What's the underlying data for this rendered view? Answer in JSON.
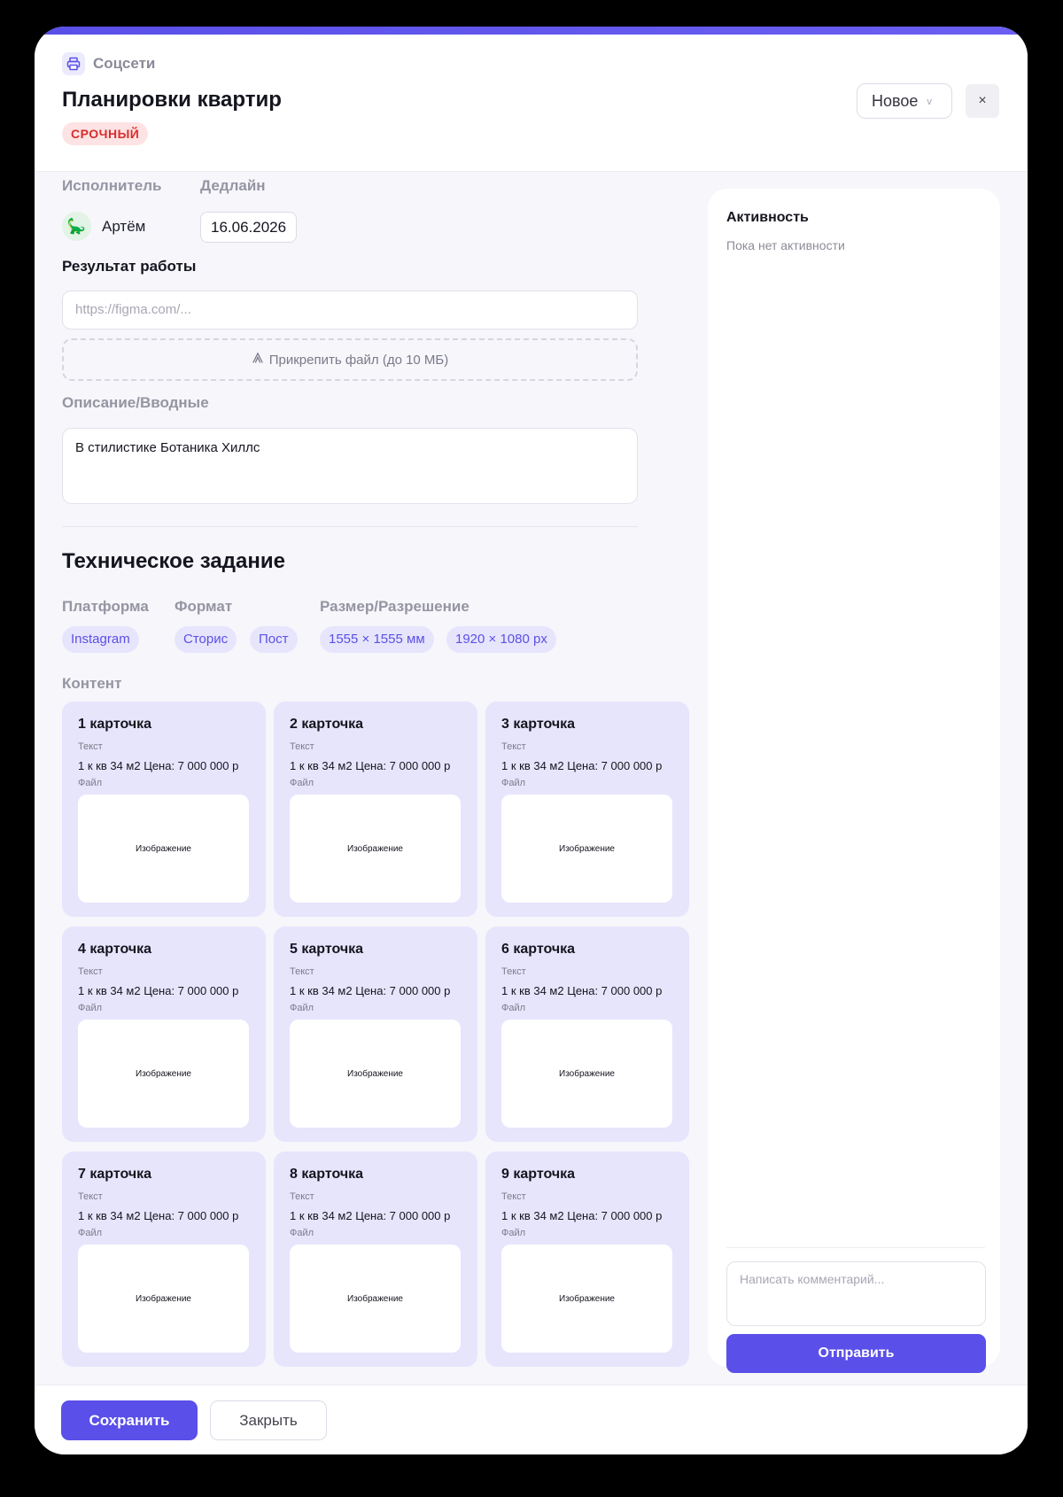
{
  "header": {
    "breadcrumb": "Соцсети",
    "breadcrumb_icon": "printer-icon",
    "title": "Планировки квартир",
    "priority_badge": "СРОЧНЫЙ",
    "status": "Новое",
    "close": "×"
  },
  "meta": {
    "assignee_label": "Исполнитель",
    "assignee_name": "Артём",
    "assignee_avatar": "🦕",
    "deadline_label": "Дедлайн",
    "deadline": "16.06.2026"
  },
  "result": {
    "label": "Результат работы",
    "url_placeholder": "https://figma.com/...",
    "attach_label": "Прикрепить файл (до 10 МБ)"
  },
  "description": {
    "label": "Описание/Вводные",
    "value": "В стилистике Ботаника Хиллс"
  },
  "tech": {
    "heading": "Техническое задание",
    "platform_label": "Платформа",
    "format_label": "Формат",
    "size_label": "Размер/Разрешение",
    "platforms": [
      "Instagram"
    ],
    "formats": [
      "Сторис",
      "Пост"
    ],
    "sizes": [
      "1555 × 1555 мм",
      "1920 × 1080 px"
    ],
    "content_label": "Контент"
  },
  "cards": [
    {
      "title": "1 карточка",
      "text_label": "Текст",
      "text": "1 к кв 34 м2 Цена: 7 000 000 р",
      "file_label": "Файл",
      "image": "Изображение"
    },
    {
      "title": "2 карточка",
      "text_label": "Текст",
      "text": "1 к кв 34 м2 Цена: 7 000 000 р",
      "file_label": "Файл",
      "image": "Изображение"
    },
    {
      "title": "3 карточка",
      "text_label": "Текст",
      "text": "1 к кв 34 м2 Цена: 7 000 000 р",
      "file_label": "Файл",
      "image": "Изображение"
    },
    {
      "title": "4 карточка",
      "text_label": "Текст",
      "text": "1 к кв 34 м2 Цена: 7 000 000 р",
      "file_label": "Файл",
      "image": "Изображение"
    },
    {
      "title": "5 карточка",
      "text_label": "Текст",
      "text": "1 к кв 34 м2 Цена: 7 000 000 р",
      "file_label": "Файл",
      "image": "Изображение"
    },
    {
      "title": "6 карточка",
      "text_label": "Текст",
      "text": "1 к кв 34 м2 Цена: 7 000 000 р",
      "file_label": "Файл",
      "image": "Изображение"
    },
    {
      "title": "7 карточка",
      "text_label": "Текст",
      "text": "1 к кв 34 м2 Цена: 7 000 000 р",
      "file_label": "Файл",
      "image": "Изображение"
    },
    {
      "title": "8 карточка",
      "text_label": "Текст",
      "text": "1 к кв 34 м2 Цена: 7 000 000 р",
      "file_label": "Файл",
      "image": "Изображение"
    },
    {
      "title": "9 карточка",
      "text_label": "Текст",
      "text": "1 к кв 34 м2 Цена: 7 000 000 р",
      "file_label": "Файл",
      "image": "Изображение"
    }
  ],
  "activity": {
    "title": "Активность",
    "empty": "Пока нет активности",
    "comment_placeholder": "Написать комментарий...",
    "send_label": "Отправить"
  },
  "footer": {
    "save_label": "Сохранить",
    "close_label": "Закрыть"
  },
  "colors": {
    "accent": "#5a4fe8",
    "chip_bg": "#e7e5fc",
    "urgent_bg": "#fde3e3",
    "urgent_text": "#d92d2d"
  }
}
